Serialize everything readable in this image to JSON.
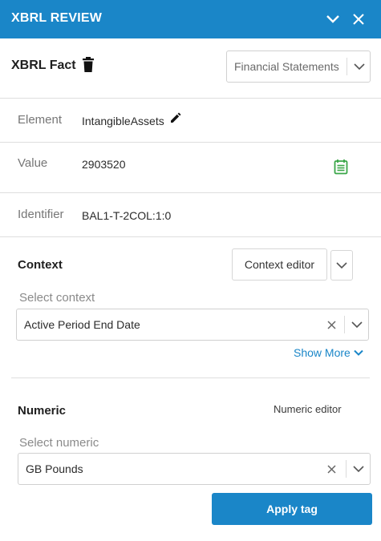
{
  "header": {
    "title": "XBRL REVIEW",
    "collapse_icon": "chevron-down-icon",
    "close_icon": "close-icon"
  },
  "fact": {
    "title": "XBRL Fact",
    "delete_icon": "trash-icon",
    "statement_select": {
      "value": "Financial Statements"
    }
  },
  "details": [
    {
      "label": "Element",
      "value": "IntangibleAssets"
    },
    {
      "label": "Value",
      "value": "2903520"
    },
    {
      "label": "Identifier",
      "value": "BAL1-T-2COL:1:0"
    }
  ],
  "context": {
    "title": "Context",
    "editor_button": "Context editor",
    "select_label": "Select context",
    "selected": "Active Period End Date",
    "show_more": "Show More"
  },
  "numeric": {
    "title": "Numeric",
    "editor_link": "Numeric editor",
    "select_label": "Select numeric",
    "selected": "GB Pounds"
  },
  "actions": {
    "apply": "Apply tag"
  },
  "colors": {
    "accent": "#1a86c8",
    "calendar_green": "#3aa648"
  }
}
